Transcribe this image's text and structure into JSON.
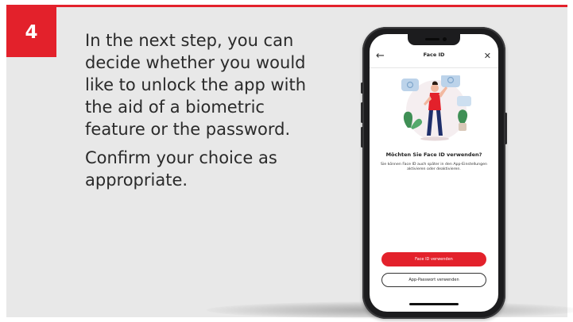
{
  "step": {
    "number": "4",
    "paragraphs": [
      "In the next step, you can decide whether you would like to unlock the app with the aid of a biometric feature or the password.",
      "Confirm your choice as appropriate."
    ]
  },
  "screen": {
    "title": "Face ID",
    "back_symbol": "←",
    "close_symbol": "✕",
    "question": "Möchten Sie Face ID verwenden?",
    "description": "Sie können Face ID auch später in den App-Einstellungen aktivieren oder deaktivieren.",
    "primary_button": "Face ID verwenden",
    "secondary_button": "App-Passwort verwenden"
  },
  "colors": {
    "accent": "#e3212b",
    "panel_background": "#e8e8e8",
    "text": "#2a2a2a"
  },
  "icons": {
    "back": "arrow-left-icon",
    "close": "close-icon",
    "illustration": "person-with-face-id-illustration"
  }
}
